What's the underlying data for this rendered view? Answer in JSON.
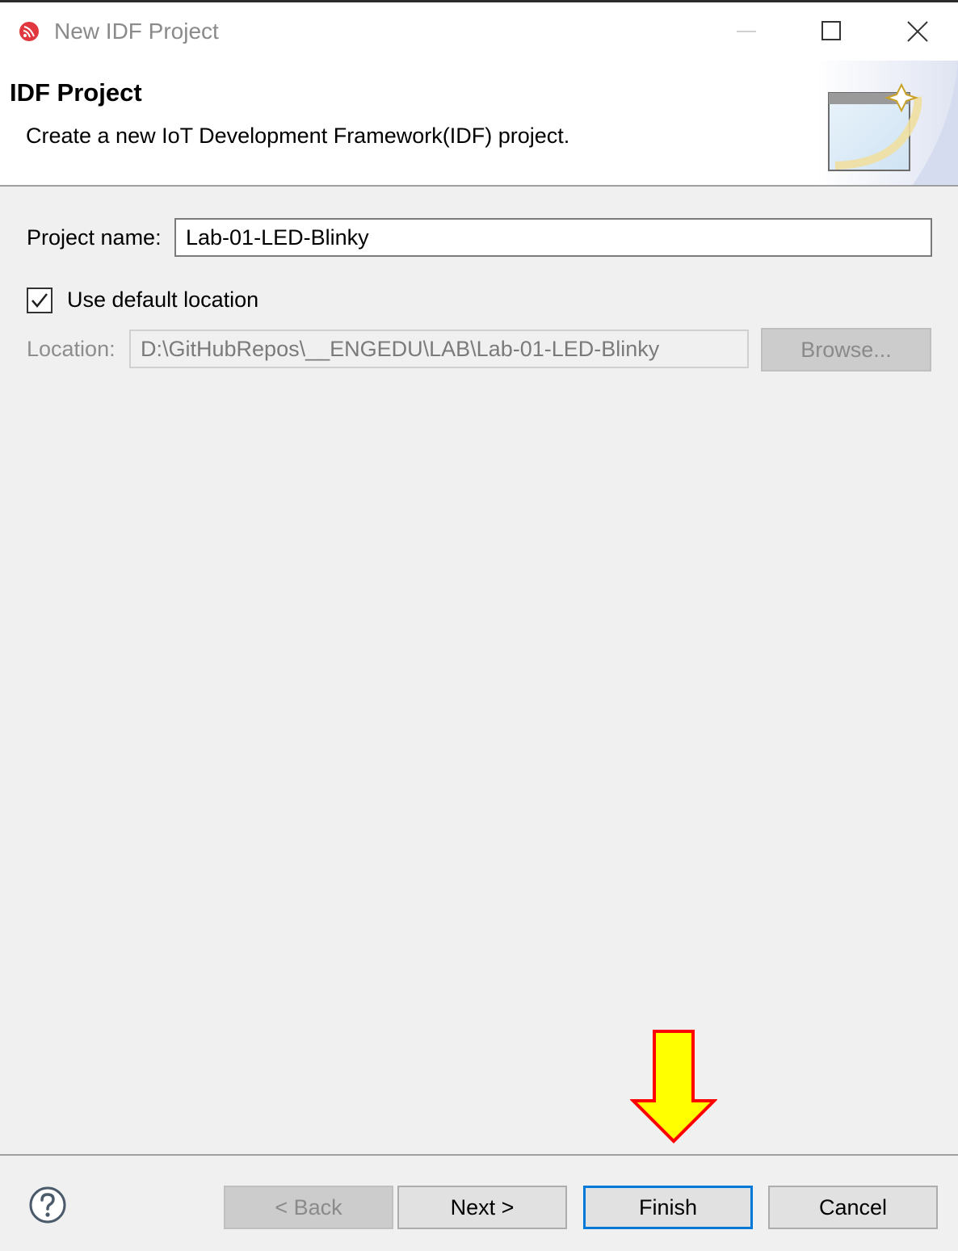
{
  "window": {
    "title": "New IDF Project",
    "controls": [
      "minimize-icon",
      "maximize-icon",
      "close-icon"
    ]
  },
  "banner": {
    "title": "IDF Project",
    "description": "Create a new IoT Development Framework(IDF) project."
  },
  "form": {
    "project_name_label": "Project name:",
    "project_name_value": "Lab-01-LED-Blinky",
    "use_default_location_label": "Use default location",
    "use_default_location_checked": true,
    "location_label": "Location:",
    "location_value": "D:\\GitHubRepos\\__ENGEDU\\LAB\\Lab-01-LED-Blinky",
    "browse_label": "Browse..."
  },
  "footer": {
    "back_label": "< Back",
    "next_label": "Next >",
    "finish_label": "Finish",
    "cancel_label": "Cancel"
  },
  "colors": {
    "accent": "#0078d7",
    "annotation_fill": "#ffff00",
    "annotation_stroke": "#ff0000"
  }
}
